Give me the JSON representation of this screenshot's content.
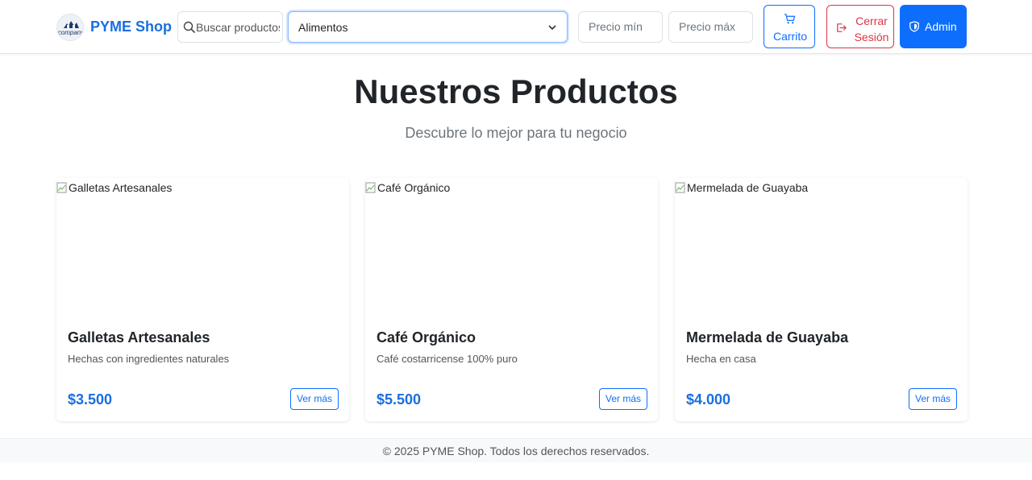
{
  "brand": {
    "name": "PYME Shop",
    "logo_text": "company"
  },
  "search": {
    "placeholder": "Buscar productos"
  },
  "category": {
    "selected": "Alimentos"
  },
  "price_filter": {
    "min_placeholder": "Precio mín",
    "max_placeholder": "Precio máx"
  },
  "actions": {
    "cart": "Carrito",
    "logout": "Cerrar Sesión",
    "admin": "Admin"
  },
  "hero": {
    "title": "Nuestros Productos",
    "subtitle": "Descubre lo mejor para tu negocio"
  },
  "products": [
    {
      "image_alt": "Galletas Artesanales",
      "name": "Galletas Artesanales",
      "description": "Hechas con ingredientes naturales",
      "price": "$3.500",
      "button": "Ver más"
    },
    {
      "image_alt": "Café Orgánico",
      "name": "Café Orgánico",
      "description": "Café costarricense 100% puro",
      "price": "$5.500",
      "button": "Ver más"
    },
    {
      "image_alt": "Mermelada de Guayaba",
      "name": "Mermelada de Guayaba",
      "description": "Hecha en casa",
      "price": "$4.000",
      "button": "Ver más"
    }
  ],
  "footer": {
    "text": "© 2025 PYME Shop. Todos los derechos reservados."
  },
  "colors": {
    "primary": "#0d6efd",
    "brand": "#1a6ee0",
    "danger": "#dc3545",
    "footer_bg": "#f8f9fa"
  },
  "icons": [
    "company-logo",
    "search-icon",
    "chevron-down-icon",
    "cart-icon",
    "logout-icon",
    "shield-icon",
    "broken-image-icon"
  ]
}
